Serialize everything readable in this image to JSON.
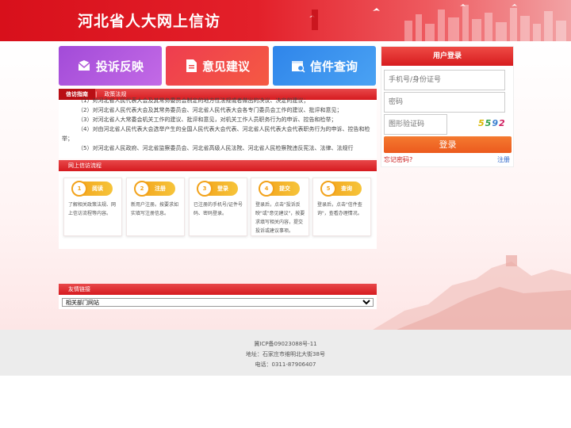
{
  "header": {
    "title": "河北省人大网上信访"
  },
  "tiles": [
    {
      "label": "投诉反映",
      "icon": "mail-icon"
    },
    {
      "label": "意见建议",
      "icon": "document-icon"
    },
    {
      "label": "信件查询",
      "icon": "calendar-search-icon"
    }
  ],
  "guide": {
    "tabs": [
      "信访指南",
      "政策法规"
    ],
    "lines": [
      "（1）对河北省人民代表大会及其常务委员会制定的地方性法规或者做出的决议、决定的建议；",
      "（2）对河北省人民代表大会及其常务委员会、河北省人民代表大会各专门委员会工作的建议、批评和意见；",
      "（3）对河北省人大常委会机关工作的建议、批评和意见，对机关工作人员职务行为的申诉、控告和检举；",
      "（4）对由河北省人民代表大会选举产生的全国人民代表大会代表、河北省人民代表大会代表职务行为的申诉、控告和检举；",
      "（5）对河北省人民政府、河北省监察委员会、河北省高级人民法院、河北省人民检察院违反宪法、法律、法规行"
    ]
  },
  "flow": {
    "title": "网上信访流程",
    "steps": [
      {
        "num": "1",
        "label": "阅读",
        "desc": "了解相关政策法规、网上信访流程等内容。"
      },
      {
        "num": "2",
        "label": "注册",
        "desc": "新用户注册。按要求如实填写注册信息。"
      },
      {
        "num": "3",
        "label": "登录",
        "desc": "已注册的手机号/证件号码、密码登录。"
      },
      {
        "num": "4",
        "label": "提交",
        "desc": "登录后，点击\"投诉反映\"或\"意见建议\"，按要求填写相关内容，提交投诉或建议事项。"
      },
      {
        "num": "5",
        "label": "查询",
        "desc": "登录后，点击\"信件查询\"，查看办理情况。"
      }
    ]
  },
  "links": {
    "title": "友情链接",
    "selected": "相关部门网站"
  },
  "login": {
    "title": "用户登录",
    "account_placeholder": "手机号/身份证号",
    "password_placeholder": "密码",
    "captcha_placeholder": "图形验证码",
    "captcha_chars": [
      "5",
      "5",
      "9",
      "2"
    ],
    "captcha_colors": [
      "#d9b800",
      "#2da04a",
      "#3a7fd0",
      "#d02060"
    ],
    "login_label": "登录",
    "forgot_label": "忘记密码?",
    "register_label": "注册"
  },
  "footer": {
    "icp": "冀ICP备09023088号-11",
    "address": "地址：石家庄市维明北大街38号",
    "phone": "电话：0311-87906407"
  }
}
